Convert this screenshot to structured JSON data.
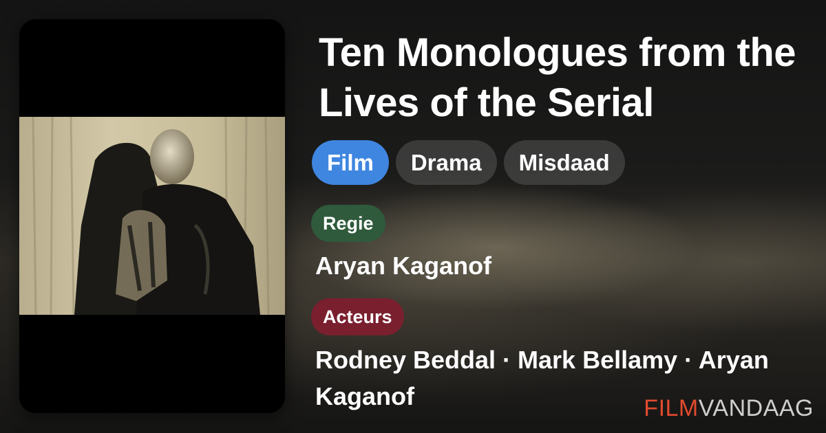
{
  "movie": {
    "title": "Ten Monologues from the Lives of the Serial",
    "poster_icon": "movie-poster-image"
  },
  "genres": [
    "Film",
    "Drama",
    "Misdaad"
  ],
  "director": {
    "label": "Regie",
    "names": "Aryan Kaganof"
  },
  "cast": {
    "label": "Acteurs",
    "names": "Rodney Beddal · Mark Bellamy · Aryan Kaganof"
  },
  "brand": {
    "part1": "FILM",
    "part2": "VANDAAG"
  },
  "colors": {
    "film_chip": "#3f86e0",
    "regie_badge": "#2f5a3c",
    "acteurs_badge": "#7a1f2e",
    "brand_accent": "#e24a2e"
  }
}
